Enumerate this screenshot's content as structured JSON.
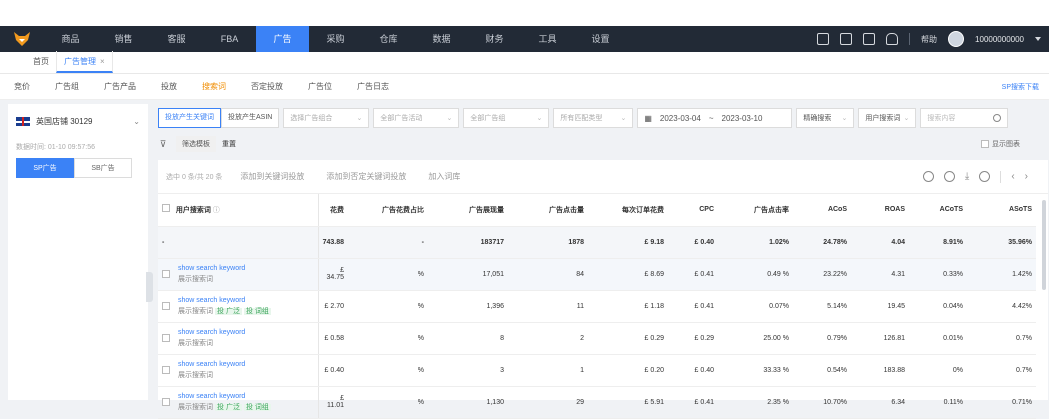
{
  "topnav": {
    "items": [
      "商品",
      "销售",
      "客服",
      "FBA",
      "广告",
      "采购",
      "仓库",
      "数据",
      "财务",
      "工具",
      "设置"
    ],
    "active_index": 4,
    "help_label": "帮助",
    "account": "10000000000"
  },
  "page_tabs": [
    {
      "label": "首页"
    },
    {
      "label": "广告管理"
    }
  ],
  "sub_tabs": {
    "items": [
      "竞价",
      "广告组",
      "广告产品",
      "投放",
      "搜索词",
      "否定投放",
      "广告位",
      "广告日志"
    ],
    "active_index": 4,
    "right_link": "SP搜索下载"
  },
  "left_panel": {
    "shop_name": "英国店铺 30129",
    "sync_time": "数据时间: 01-10 09:57:56",
    "type_buttons": [
      "SP广告",
      "SB广告"
    ]
  },
  "filters": {
    "segment": [
      "投放产生关键词",
      "投放产生ASIN"
    ],
    "selects": [
      "选择广告组合",
      "全部广告活动",
      "全部广告组",
      "所有匹配类型"
    ],
    "date_start": "2023-03-04",
    "date_sep": "~",
    "date_end": "2023-03-10",
    "match_select": "精确搜索",
    "field_select": "用户搜索词",
    "search_placeholder": "搜索内容"
  },
  "filters2": {
    "chip": "筛选模板",
    "reset": "重置",
    "chart_toggle": "显示图表"
  },
  "toolbar": {
    "selected": "选中 0 条/共 20 条",
    "actions": [
      "添加到关键词投放",
      "添加到否定关键词投放",
      "加入词库"
    ]
  },
  "table": {
    "headers": [
      "用户搜索词",
      "花费",
      "广告花费占比",
      "广告展现量",
      "广告点击量",
      "每次订单花费",
      "CPC",
      "广告点击率",
      "ACoS",
      "ROAS",
      "ACoTS",
      "ASoTS"
    ],
    "total": [
      "-",
      "743.88",
      "-",
      "183717",
      "1878",
      "£ 9.18",
      "£ 0.40",
      "1.02%",
      "24.78%",
      "4.04",
      "8.91%",
      "35.96%"
    ],
    "rows": [
      {
        "kw": "show search keyword",
        "sub": "展示搜索词",
        "tags": [],
        "cells": [
          "£ 34.75",
          "%",
          "17,051",
          "84",
          "£ 8.69",
          "£ 0.41",
          "0.49 %",
          "23.22%",
          "4.31",
          "0.33%",
          "1.42%"
        ]
      },
      {
        "kw": "show search keyword",
        "sub": "展示搜索词",
        "tags": [
          "投 广泛",
          "投 词组"
        ],
        "cells": [
          "£ 2.70",
          "%",
          "1,396",
          "11",
          "£ 1.18",
          "£ 0.41",
          "0.07%",
          "5.14%",
          "19.45",
          "0.04%",
          "4.42%"
        ]
      },
      {
        "kw": "show search keyword",
        "sub": "展示搜索词",
        "tags": [],
        "cells": [
          "£ 0.58",
          "%",
          "8",
          "2",
          "£ 0.29",
          "£ 0.29",
          "25.00 %",
          "0.79%",
          "126.81",
          "0.01%",
          "0.7%"
        ]
      },
      {
        "kw": "show search keyword",
        "sub": "展示搜索词",
        "tags": [],
        "cells": [
          "£ 0.40",
          "%",
          "3",
          "1",
          "£ 0.20",
          "£ 0.40",
          "33.33 %",
          "0.54%",
          "183.88",
          "0%",
          "0.7%"
        ]
      },
      {
        "kw": "show search keyword",
        "sub": "展示搜索词",
        "tags": [
          "投 广泛",
          "投 词组"
        ],
        "cells": [
          "£ 11.01",
          "%",
          "1,130",
          "29",
          "£ 5.91",
          "£ 0.41",
          "2.35 %",
          "10.70%",
          "6.34",
          "0.11%",
          "0.71%"
        ]
      }
    ]
  }
}
